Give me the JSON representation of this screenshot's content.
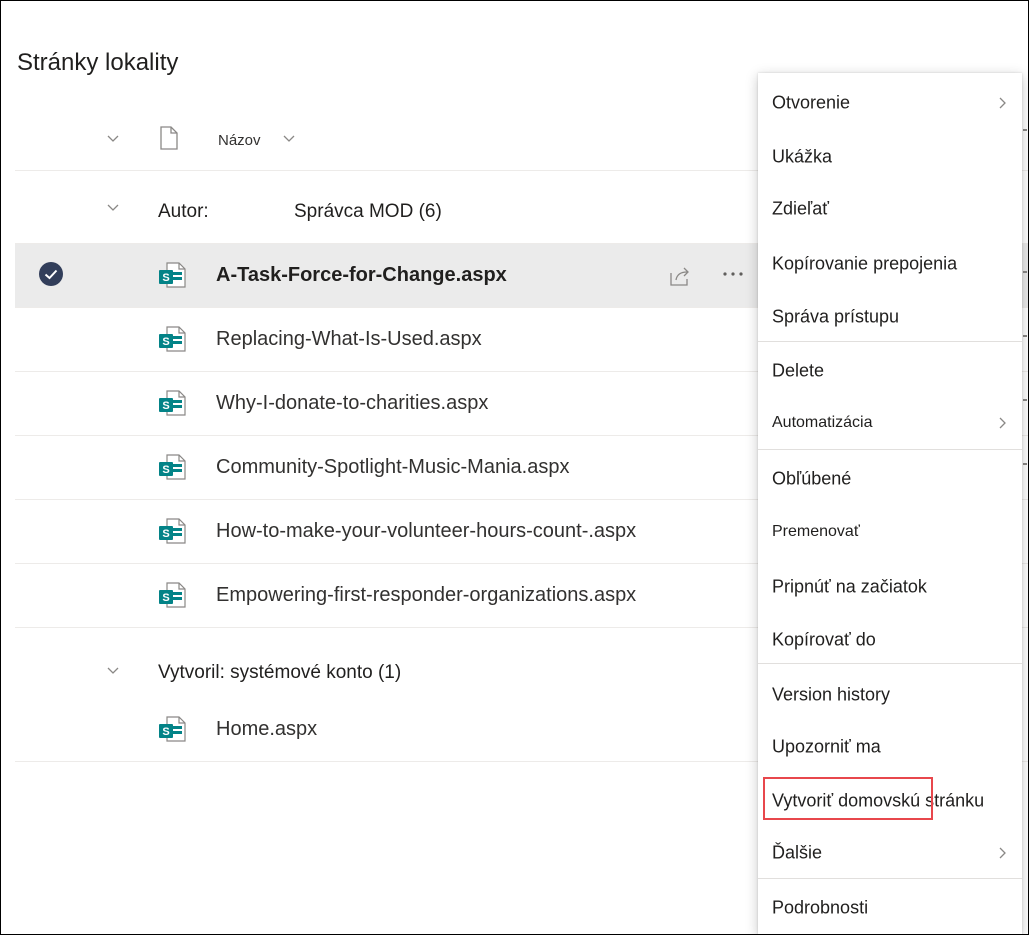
{
  "page": {
    "title": "Stránky lokality"
  },
  "list": {
    "header": {
      "name_col": "Názov"
    },
    "groups": [
      {
        "label": "Autor:",
        "value": "Správca MOD (6)",
        "files": [
          "A-Task-Force-for-Change.aspx",
          "Replacing-What-Is-Used.aspx",
          "Why-I-donate-to-charities.aspx",
          "Community-Spotlight-Music-Mania.aspx",
          "How-to-make-your-volunteer-hours-count-.aspx",
          "Empowering-first-responder-organizations.aspx"
        ]
      },
      {
        "label": "Vytvoril: systémové konto (1)",
        "files": [
          "Home.aspx"
        ]
      }
    ],
    "selected_file": "A-Task-Force-for-Change.aspx"
  },
  "context_menu": {
    "items": [
      {
        "label": "Otvorenie",
        "submenu": true
      },
      {
        "label": "Ukážka"
      },
      {
        "label": "Zdieľať"
      },
      {
        "label": "Kopírovanie prepojenia"
      },
      {
        "label": "Správa prístupu"
      },
      {
        "label": "Delete"
      },
      {
        "label": "Automatizácia",
        "submenu": true
      },
      {
        "label": "Obľúbené"
      },
      {
        "label": "Premenovať"
      },
      {
        "label": "Pripnúť na začiatok"
      },
      {
        "label": "Kopírovať do"
      },
      {
        "label": "Version history"
      },
      {
        "label": "Upozorniť ma"
      },
      {
        "label": "Vytvoriť domovskú stránku",
        "highlighted": true
      },
      {
        "label": "Ďalšie",
        "submenu": true
      },
      {
        "label": "Podrobnosti"
      }
    ],
    "highlight_color": "#e8474c"
  },
  "icons": {
    "file": "sharepoint-page-icon",
    "check": "checkmark-circle-icon",
    "share": "share-icon",
    "more": "more-ellipsis-icon",
    "chevron": "chevron-down-icon",
    "submenu": "chevron-right-icon"
  },
  "colors": {
    "sharepoint_teal": "#038387",
    "selected_row": "#ebebeb",
    "check_fill": "#323e5a"
  }
}
